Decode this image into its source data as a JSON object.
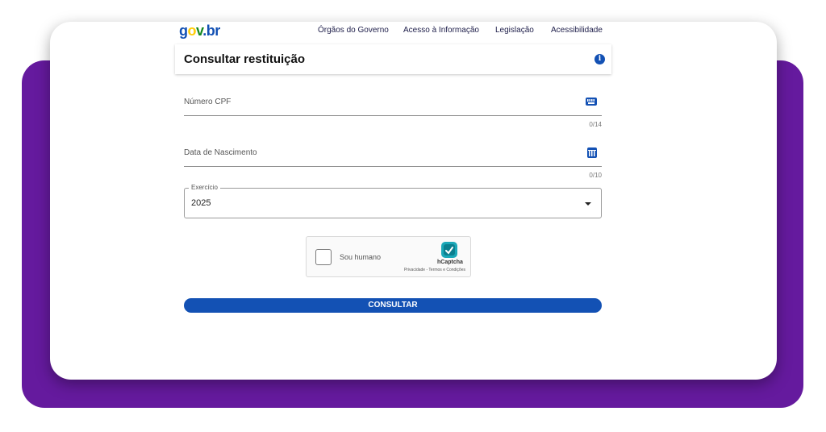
{
  "brand": {
    "logo_text": "gov.br",
    "colors": {
      "blue": "#1351b4",
      "yellow": "#ffcd07",
      "green": "#168821",
      "purple_bg": "#651a9e"
    }
  },
  "nav": {
    "links": [
      {
        "label": "Órgãos do Governo"
      },
      {
        "label": "Acesso à Informação"
      },
      {
        "label": "Legislação"
      },
      {
        "label": "Acessibilidade"
      }
    ]
  },
  "header": {
    "title": "Consultar restituição",
    "info_icon": "info-icon"
  },
  "form": {
    "cpf": {
      "placeholder": "Número CPF",
      "value": "",
      "counter": "0/14",
      "icon": "keyboard-icon"
    },
    "birthdate": {
      "placeholder": "Data de Nascimento",
      "value": "",
      "counter": "0/10",
      "icon": "calendar-icon"
    },
    "exercise": {
      "label": "Exercício",
      "selected": "2025",
      "icon": "caret-down-icon"
    },
    "captcha": {
      "label": "Sou humano",
      "brand": "hCaptcha",
      "links": "Privacidade - Termos e Condições",
      "checked": false
    },
    "submit_label": "CONSULTAR"
  }
}
